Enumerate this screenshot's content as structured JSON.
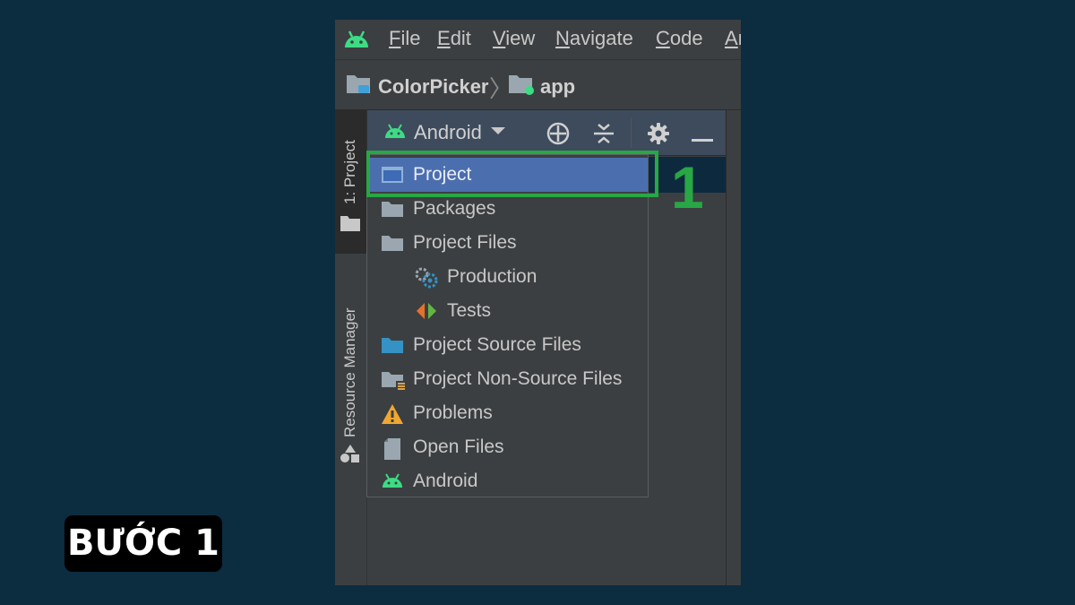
{
  "menubar": {
    "items": [
      {
        "label": "File"
      },
      {
        "label": "Edit"
      },
      {
        "label": "View"
      },
      {
        "label": "Navigate"
      },
      {
        "label": "Code"
      },
      {
        "label": "An"
      }
    ]
  },
  "breadcrumb": {
    "project": "ColorPicker",
    "module": "app"
  },
  "sidebar": {
    "project_tab": "1: Project",
    "resource_tab": "Resource Manager"
  },
  "panel": {
    "view_selector": "Android"
  },
  "dropdown": {
    "items": [
      {
        "label": "Project",
        "icon": "project-window-icon",
        "selected": true
      },
      {
        "label": "Packages",
        "icon": "folder-icon"
      },
      {
        "label": "Project Files",
        "icon": "folder-icon"
      },
      {
        "label": "Production",
        "icon": "gears-icon"
      },
      {
        "label": "Tests",
        "icon": "tests-icon"
      },
      {
        "label": "Project Source Files",
        "icon": "blue-folder-icon"
      },
      {
        "label": "Project Non-Source Files",
        "icon": "non-source-folder-icon"
      },
      {
        "label": "Problems",
        "icon": "warning-icon"
      },
      {
        "label": "Open Files",
        "icon": "file-icon"
      },
      {
        "label": "Android",
        "icon": "android-icon"
      }
    ]
  },
  "annotation": {
    "step_number": "1",
    "step_badge": "BƯỚC 1",
    "highlight_color": "#28a745"
  },
  "colors": {
    "background": "#0c2c40",
    "ide_background": "#3c3f41",
    "selection": "#4b6eaf",
    "android_green": "#3ddc84"
  }
}
